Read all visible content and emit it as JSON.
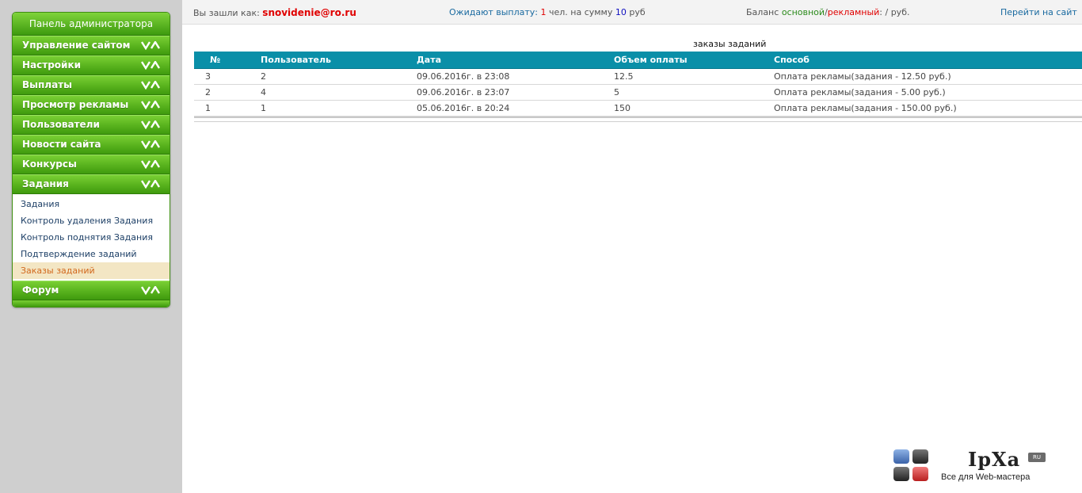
{
  "sidebar": {
    "title": "Панель администратора",
    "items": [
      {
        "label": "Управление сайтом"
      },
      {
        "label": "Настройки"
      },
      {
        "label": "Выплаты"
      },
      {
        "label": "Просмотр рекламы"
      },
      {
        "label": "Пользователи"
      },
      {
        "label": "Новости сайта"
      },
      {
        "label": "Конкурсы"
      },
      {
        "label": "Задания"
      },
      {
        "label": "Форум"
      }
    ],
    "submenu": [
      {
        "label": "Задания"
      },
      {
        "label": "Контроль удаления Задания"
      },
      {
        "label": "Контроль поднятия Задания"
      },
      {
        "label": "Подтверждение заданий"
      },
      {
        "label": "Заказы заданий",
        "active": true
      }
    ]
  },
  "topbar": {
    "logged_as_label": "Вы зашли как:",
    "email": "snovidenie@ro.ru",
    "pending_label": "Ожидают выплату:",
    "pending_count": "1",
    "pending_mid": "чел. на сумму",
    "pending_sum": "10",
    "pending_currency": "руб",
    "balance_label": "Баланс",
    "balance_main": "основной",
    "balance_sep": "/",
    "balance_ads": "рекламный",
    "balance_tail": ": / руб.",
    "goto_site": "Перейти на сайт"
  },
  "main": {
    "caption": "заказы заданий",
    "table": {
      "headers": [
        "№",
        "Пользователь",
        "Дата",
        "Объем оплаты",
        "Способ"
      ],
      "rows": [
        [
          "3",
          "2",
          "09.06.2016г. в 23:08",
          "12.5",
          "Оплата рекламы(задания - 12.50 руб.)"
        ],
        [
          "2",
          "4",
          "09.06.2016г. в 23:07",
          "5",
          "Оплата рекламы(задания - 5.00 руб.)"
        ],
        [
          "1",
          "1",
          "05.06.2016г. в 20:24",
          "150",
          "Оплата рекламы(задания - 150.00 руб.)"
        ]
      ]
    }
  },
  "logo": {
    "name": "IpXa",
    "badge": "RU",
    "tagline": "Все для Web-мастера"
  },
  "colors": {
    "menu_green": "#58b21d",
    "table_header": "#0a8fa8",
    "active_sub_bg": "#f3e6c4",
    "active_sub_text": "#d2691e",
    "email_red": "#e00000"
  }
}
